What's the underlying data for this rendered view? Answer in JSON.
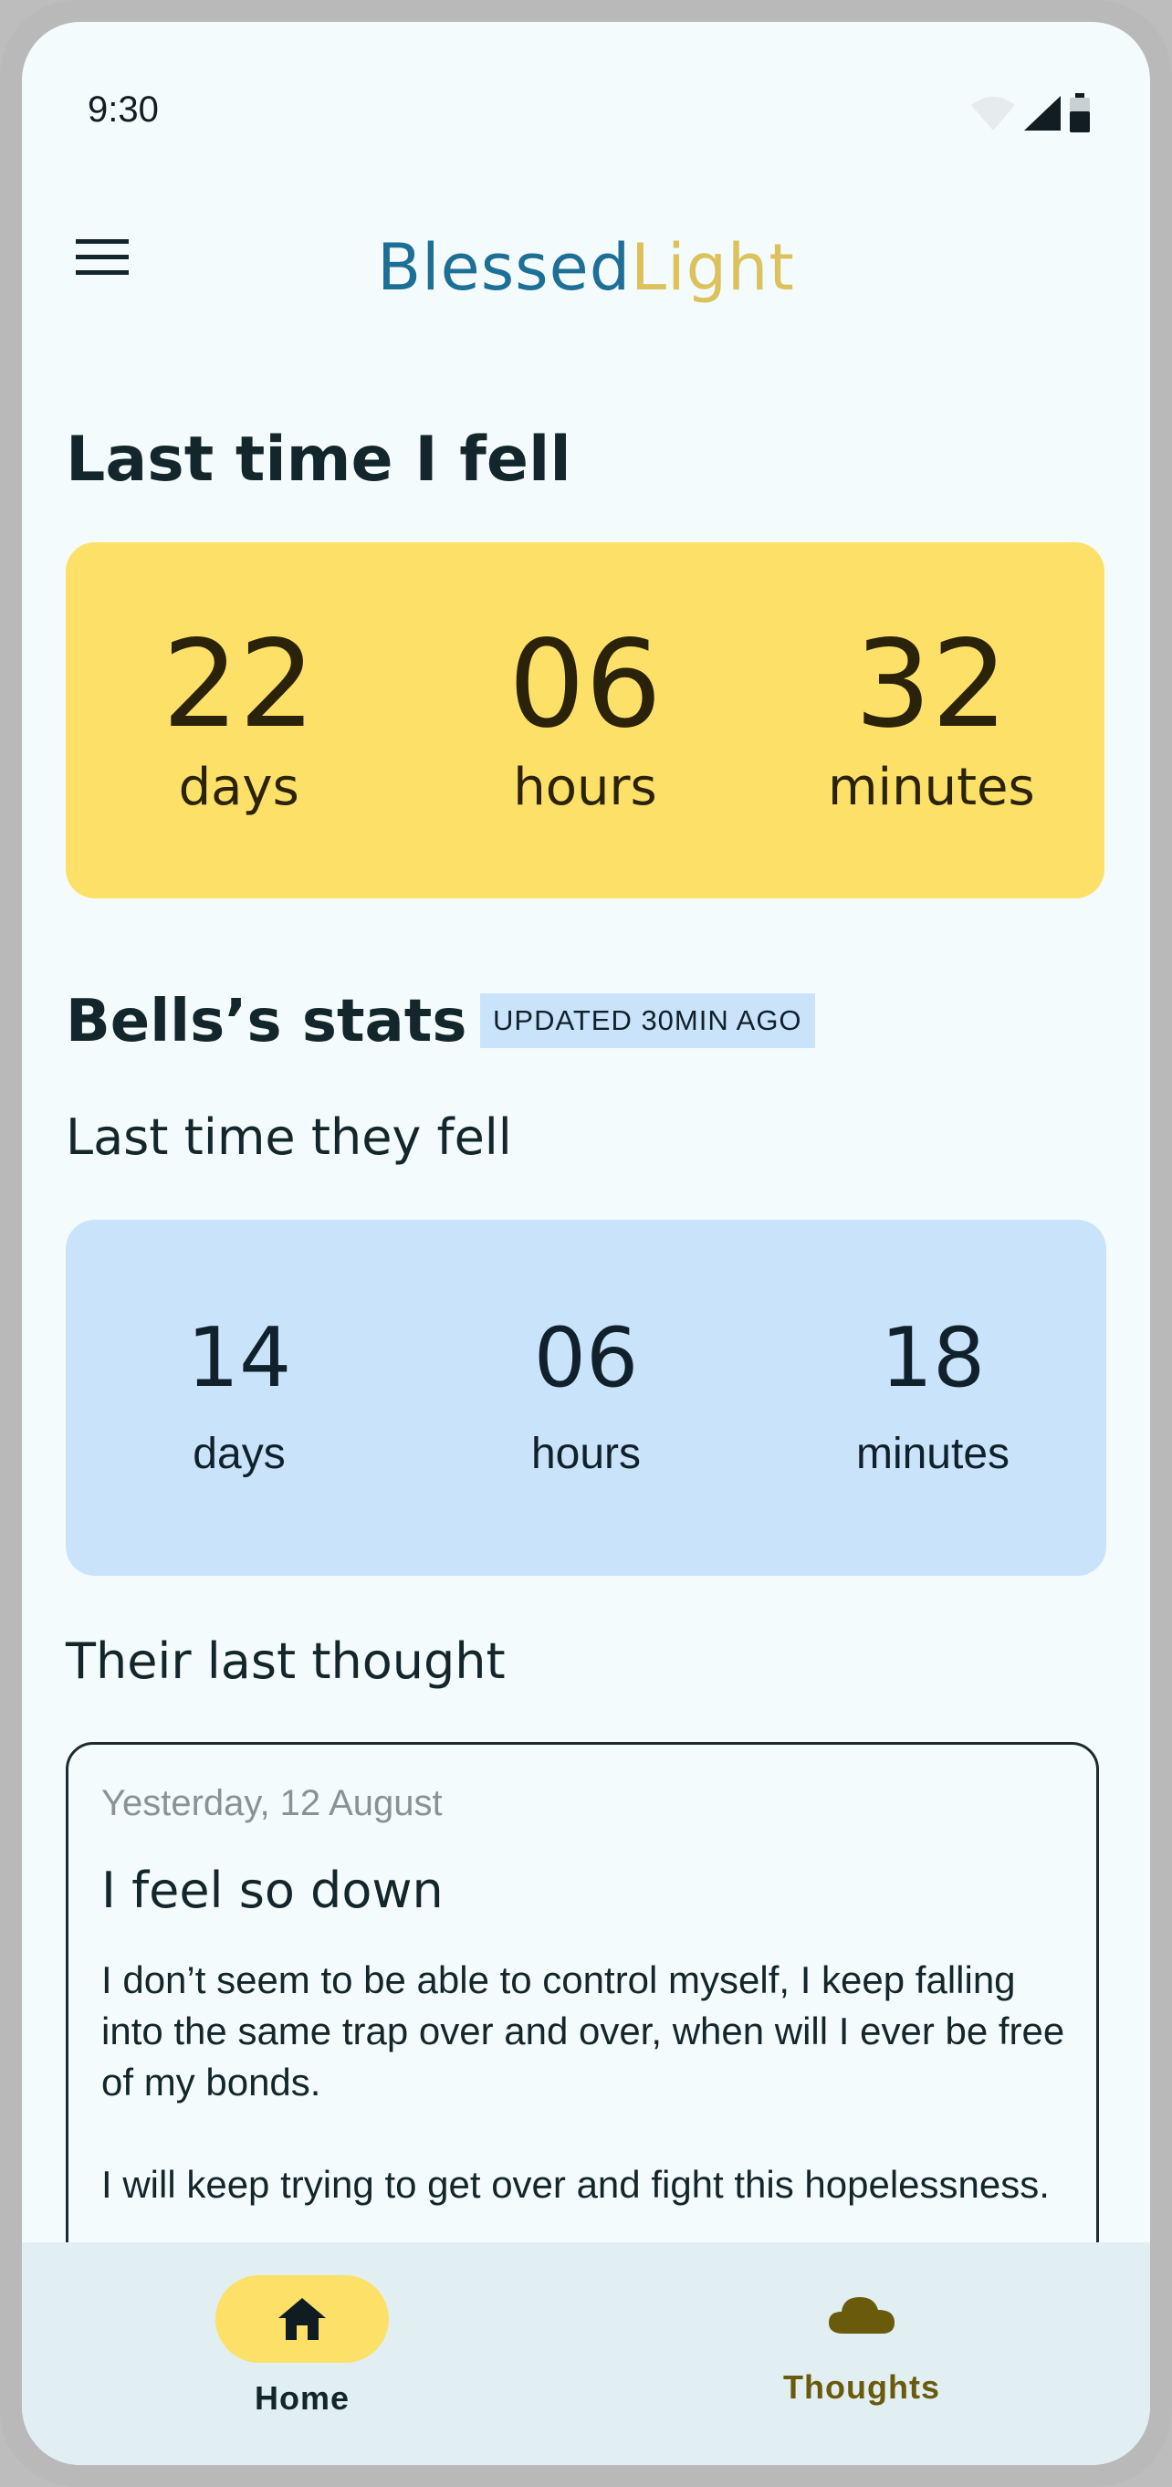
{
  "status_bar": {
    "time": "9:30",
    "icons": [
      "wifi-icon",
      "signal-icon",
      "battery-icon"
    ]
  },
  "app_bar": {
    "menu_icon": "menu-icon",
    "brand_part1": "Blessed",
    "brand_part2": "Light"
  },
  "my_section": {
    "title": "Last time I fell",
    "counter": [
      {
        "value": "22",
        "unit": "days"
      },
      {
        "value": "06",
        "unit": "hours"
      },
      {
        "value": "32",
        "unit": "minutes"
      }
    ]
  },
  "partner_section": {
    "title": "Bells’s stats",
    "badge": "UPDATED 30MIN AGO",
    "subtitle": "Last time they fell",
    "counter": [
      {
        "value": "14",
        "unit": "days"
      },
      {
        "value": "06",
        "unit": "hours"
      },
      {
        "value": "18",
        "unit": "minutes"
      }
    ]
  },
  "thought_section": {
    "title": "Their last thought",
    "card": {
      "date": "Yesterday, 12 August",
      "title": "I feel so down",
      "paragraphs": [
        "I don’t seem to be able to control myself, I keep falling into the same trap over and over, when will I ever be free of my bonds.",
        "I will keep trying to get over and fight this hopelessness."
      ]
    }
  },
  "bottom_nav": {
    "items": [
      {
        "label": "Home",
        "icon": "home-icon",
        "active": true
      },
      {
        "label": "Thoughts",
        "icon": "cloud-icon",
        "active": false
      }
    ]
  },
  "colors": {
    "background": "#f4fbfc",
    "brand_blue": "#1e6f96",
    "brand_gold": "#dcc25c",
    "accent_yellow": "#fde068",
    "accent_blue": "#c9e3fb",
    "nav_background": "#e1eff3",
    "thoughts_label": "#6a5a0c"
  }
}
